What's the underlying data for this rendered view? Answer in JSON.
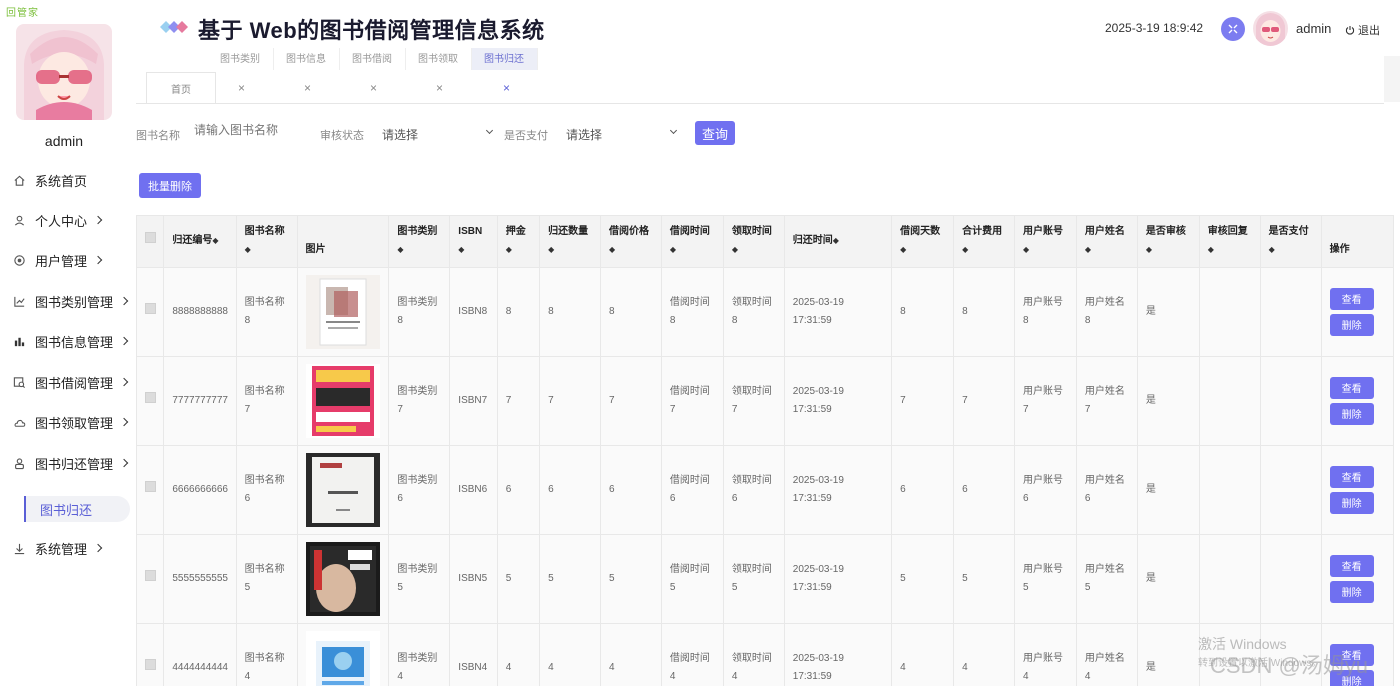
{
  "app": {
    "corner_mark": "回管家",
    "title": "基于 Web的图书借阅管理信息系统",
    "datetime": "2025-3-19 18:9:42",
    "username": "admin",
    "logout_label": "退出"
  },
  "sidebar": {
    "username": "admin",
    "items": [
      {
        "label": "系统首页",
        "icon": "home-icon",
        "has_arrow": false
      },
      {
        "label": "个人中心",
        "icon": "user-icon",
        "has_arrow": true
      },
      {
        "label": "用户管理",
        "icon": "target-icon",
        "has_arrow": true
      },
      {
        "label": "图书类别管理",
        "icon": "line-chart-icon",
        "has_arrow": true
      },
      {
        "label": "图书信息管理",
        "icon": "bar-chart-icon",
        "has_arrow": true
      },
      {
        "label": "图书借阅管理",
        "icon": "search-chart-icon",
        "has_arrow": true
      },
      {
        "label": "图书领取管理",
        "icon": "cloud-icon",
        "has_arrow": true
      },
      {
        "label": "图书归还管理",
        "icon": "user-outline-icon",
        "has_arrow": true
      },
      {
        "label": "系统管理",
        "icon": "download-icon",
        "has_arrow": true
      }
    ],
    "active_sub_item": "图书归还"
  },
  "tabs": {
    "top_titles": [
      "图书类别",
      "图书信息",
      "图书借阅",
      "图书领取",
      "图书归还"
    ],
    "active_index": 4,
    "home_label": "首页",
    "close_glyph": "×"
  },
  "search": {
    "name_label": "图书名称",
    "name_placeholder": "请输入图书名称",
    "review_label": "审核状态",
    "review_value": "请选择",
    "pay_label": "是否支付",
    "pay_value": "请选择",
    "query_button": "查询",
    "batch_delete_button": "批量删除"
  },
  "table": {
    "columns": [
      "归还编号",
      "图书名称",
      "图片",
      "图书类别",
      "ISBN",
      "押金",
      "归还数量",
      "借阅价格",
      "借阅时间",
      "领取时间",
      "归还时间",
      "借阅天数",
      "合计费用",
      "用户账号",
      "用户姓名",
      "是否审核",
      "审核回复",
      "是否支付",
      "操作"
    ],
    "sort_glyph": "◆",
    "view_button": "查看",
    "delete_button": "删除",
    "rows": [
      {
        "id": "8888888888",
        "name": "图书名称8",
        "category": "图书类别8",
        "isbn": "ISBN8",
        "deposit": "8",
        "qty": "8",
        "price": "8",
        "borrow_time": "借阅时间8",
        "pickup_time": "领取时间8",
        "return_date": "2025-03-19",
        "return_clock": "17:31:59",
        "days": "8",
        "total": "8",
        "account": "用户账号8",
        "username": "用户姓名8",
        "reviewed": "是",
        "reply": "",
        "paid": "",
        "cover": "cover-8"
      },
      {
        "id": "7777777777",
        "name": "图书名称7",
        "category": "图书类别7",
        "isbn": "ISBN7",
        "deposit": "7",
        "qty": "7",
        "price": "7",
        "borrow_time": "借阅时间7",
        "pickup_time": "领取时间7",
        "return_date": "2025-03-19",
        "return_clock": "17:31:59",
        "days": "7",
        "total": "7",
        "account": "用户账号7",
        "username": "用户姓名7",
        "reviewed": "是",
        "reply": "",
        "paid": "",
        "cover": "cover-7"
      },
      {
        "id": "6666666666",
        "name": "图书名称6",
        "category": "图书类别6",
        "isbn": "ISBN6",
        "deposit": "6",
        "qty": "6",
        "price": "6",
        "borrow_time": "借阅时间6",
        "pickup_time": "领取时间6",
        "return_date": "2025-03-19",
        "return_clock": "17:31:59",
        "days": "6",
        "total": "6",
        "account": "用户账号6",
        "username": "用户姓名6",
        "reviewed": "是",
        "reply": "",
        "paid": "",
        "cover": "cover-6"
      },
      {
        "id": "5555555555",
        "name": "图书名称5",
        "category": "图书类别5",
        "isbn": "ISBN5",
        "deposit": "5",
        "qty": "5",
        "price": "5",
        "borrow_time": "借阅时间5",
        "pickup_time": "领取时间5",
        "return_date": "2025-03-19",
        "return_clock": "17:31:59",
        "days": "5",
        "total": "5",
        "account": "用户账号5",
        "username": "用户姓名5",
        "reviewed": "是",
        "reply": "",
        "paid": "",
        "cover": "cover-5"
      },
      {
        "id": "4444444444",
        "name": "图书名称4",
        "category": "图书类别4",
        "isbn": "ISBN4",
        "deposit": "4",
        "qty": "4",
        "price": "4",
        "borrow_time": "借阅时间4",
        "pickup_time": "领取时间4",
        "return_date": "2025-03-19",
        "return_clock": "17:31:59",
        "days": "4",
        "total": "4",
        "account": "用户账号4",
        "username": "用户姓名4",
        "reviewed": "是",
        "reply": "",
        "paid": "",
        "cover": "cover-4"
      }
    ]
  },
  "watermark": {
    "activate_line1": "激活 Windows",
    "activate_line2": "转到设置以激活 Windows。",
    "csdn": "CSDN @汤姆yu"
  },
  "colors": {
    "accent": "#7070f0",
    "active_text": "#5a5fd6"
  }
}
